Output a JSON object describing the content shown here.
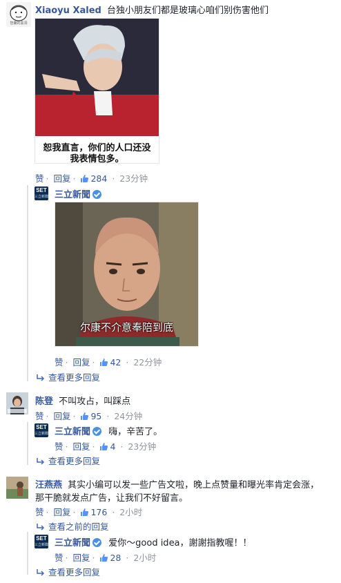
{
  "thread": {
    "c1": {
      "author": "Xiaoyu Xaled",
      "text": "台独小朋友们都是玻璃心咱们别伤害他们",
      "avatar_caption": "智囊的黑洞",
      "meme_caption_line1": "恕我直言，你们的人口还没",
      "meme_caption_line2": "我表情包多。",
      "like_label": "赞",
      "reply_label": "回复",
      "like_count": "284",
      "time": "23分钟"
    },
    "r1": {
      "author": "三立新聞",
      "logo_text": "SET",
      "logo_sub": "三立新聞",
      "meme_caption": "尔康不介意奉陪到底",
      "like_label": "赞",
      "reply_label": "回复",
      "like_count": "42",
      "time": "22分钟"
    },
    "more1": "查看更多回复",
    "c2": {
      "author": "陈登",
      "text": "不叫攻占，叫踩点",
      "like_label": "赞",
      "reply_label": "回复",
      "like_count": "95",
      "time": "24分钟"
    },
    "r2": {
      "author": "三立新聞",
      "logo_text": "SET",
      "logo_sub": "三立新聞",
      "text": "嗨，辛苦了。",
      "like_label": "赞",
      "reply_label": "回复",
      "like_count": "4",
      "time": "23分钟"
    },
    "more2": "查看更多回复",
    "c3": {
      "author": "汪燕燕",
      "text_line1": "其实小编可以发一些广告文啦，晚上点赞量和曝光率肯定会涨，",
      "text_line2": "那干脆就发点广告，让我们不好留言。",
      "like_label": "赞",
      "reply_label": "回复",
      "like_count": "176",
      "time": "2小时"
    },
    "prev": "查看之前的回复",
    "r3": {
      "author": "三立新聞",
      "logo_text": "SET",
      "logo_sub": "三立新聞",
      "text": "爱你～good idea，謝謝指教喔！！",
      "like_label": "赞",
      "reply_label": "回复",
      "like_count": "28",
      "time": "2小时"
    },
    "more3": "查看更多回复"
  },
  "colors": {
    "name_link": "#365899",
    "meta_gray": "#90949c",
    "thread_line": "#dddfe2",
    "verified_blue": "#4a90e2",
    "set_logo_bg": "#0d2b4f"
  },
  "icons": [
    "thumbs-up-icon",
    "reply-arrow-icon",
    "verified-badge-icon"
  ]
}
